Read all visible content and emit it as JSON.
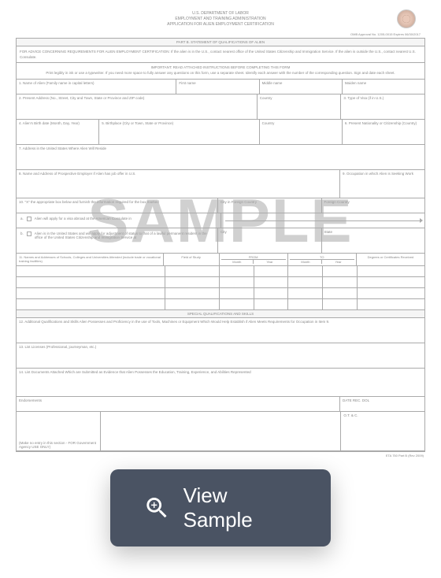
{
  "header": {
    "dept": "U.S. DEPARTMENT OF LABOR",
    "admin": "EMPLOYMENT AND TRAINING ADMINISTRATION",
    "app": "APPLICATION FOR ALIEN EMPLOYMENT CERTIFICATION"
  },
  "omb": "OMB Approval No. 1205-0015     Expires 06/30/2017",
  "partB": "PART B. STATEMENT OF QUALIFICATIONS OF ALIEN",
  "advice": "FOR ADVICE CONCERNING REQUIREMENTS FOR ALIEN EMPLOYMENT CERTIFICATION: If the alien is in the U.S., contact nearest office of the United States Citizenship and Immigration Service. If the alien is outside the U.S., contact nearest U.S. Consulate.",
  "important": "IMPORTANT: READ ATTACHED INSTRUCTIONS BEFORE COMPLETING THIS FORM",
  "imp2": "Print legibly in ink or use a typewriter. If you need more space to fully answer any questions on this form, use a separate sheet. Identify each answer with the number of the corresponding question. Sign and date each sheet.",
  "f1": "1. Name of Alien   (Family name in capital letters)",
  "f1b": "First name",
  "f1c": "Middle name",
  "f1d": "Maiden name",
  "f2": "2. Present Address     (No., Street, City and Town, State or Province and ZIP code)",
  "f2b": "Country",
  "f3": "3. Type of Visa (if in U.S.)",
  "f4": "4. Alien's Birth date (Month, Day, Year)",
  "f5": "5. Birthplace (City or Town, State or Province)",
  "f5b": "Country",
  "f6": "6. Present Nationality or Citizenship (Country)",
  "f7": "7. Address in the United States Where Alien Will Reside",
  "f8": "8. Name and Address of Prospective Employer if Alien has job offer in U.S.",
  "f9": "9. Occupation in which Alien is Seeking Work",
  "f10": "10. \"X\" the appropriate box below and furnish the information required for the box marked",
  "f10a": "Alien will apply for a visa abroad at the American Consulate in",
  "f10a2": "City in Foreign Country",
  "f10a3": "Foreign Country",
  "f10b": "Alien is in the United States and will apply for adjustment of status to that of a lawful permanent resident in the office of the United States Citizenship and Immigration Service at",
  "f10b2": "City",
  "f10b3": "State",
  "f11": "11. Names and Addresses of Schools, Colleges and Universities Attended (include trade or vocational training facilities)",
  "th1": "Field of Study",
  "th2": "FROM",
  "th3": "TO",
  "th4": "Degrees or Certificates Received",
  "thm": "Month",
  "thy": "Year",
  "spq": "SPECIAL QUALIFICATIONS AND SKILLS",
  "f12": "12. Additional Qualifications and Skills Alien Possesses and Proficiency in the use of Tools, Machines or Equipment Which Would Help Establish if Alien Meets Requirements for Occupation in Item 9.",
  "f13": "13. List Licenses   (Professional, journeyman, etc.)",
  "f14": "14. List Documents Attached Which are Submitted as Evidence that Alien Possesses the Education, Training, Experience, and Abilities Represented",
  "end": "Endorsements",
  "dr": "DATE REC. DOL",
  "note": "(Make no entry in this section - FOR Government Agency USE ONLY)",
  "ot": "O.T. & C.",
  "formno": "ETA 750 Part B (Rev 2009)",
  "watermark": "SAMPLE",
  "button": "View Sample"
}
